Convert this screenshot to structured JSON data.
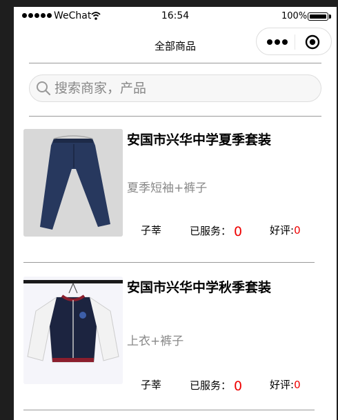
{
  "status_bar": {
    "carrier": "WeChat",
    "time": "16:54",
    "battery": "100%"
  },
  "navbar": {
    "title": "全部商品"
  },
  "search": {
    "placeholder": "搜索商家，产品"
  },
  "products": [
    {
      "name": "安国市兴华中学夏季套装",
      "desc": "夏季短袖+裤子",
      "shop": "子莘",
      "served_label": "已服务：",
      "served_count": "0",
      "rating_label": "好评:",
      "rating_count": "0",
      "image": "navy-pants"
    },
    {
      "name": "安国市兴华中学秋季套装",
      "desc": "上衣+裤子",
      "shop": "子莘",
      "served_label": "已服务：",
      "served_count": "0",
      "rating_label": "好评:",
      "rating_count": "0",
      "image": "navy-white-jacket"
    }
  ],
  "colors": {
    "accent_red": "#ee0000",
    "muted": "#888888"
  }
}
